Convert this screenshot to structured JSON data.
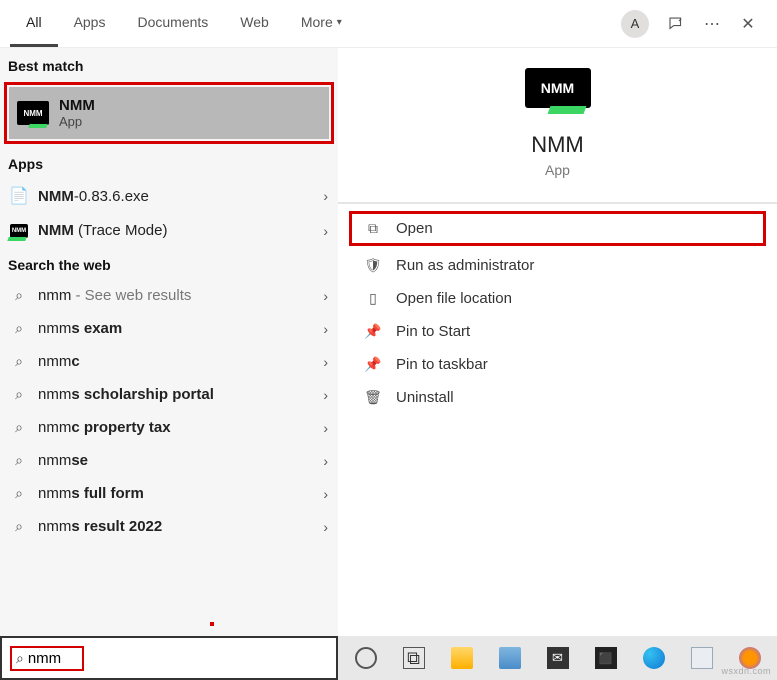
{
  "header": {
    "tabs": [
      "All",
      "Apps",
      "Documents",
      "Web",
      "More"
    ],
    "avatar": "A"
  },
  "sections": {
    "best_match": "Best match",
    "apps": "Apps",
    "search_web": "Search the web"
  },
  "best": {
    "title": "NMM",
    "subtitle": "App"
  },
  "apps_list": [
    {
      "name_bold": "NMM",
      "name_rest": "-0.83.6.exe"
    },
    {
      "name_bold": "NMM",
      "name_rest": " (Trace Mode)"
    }
  ],
  "web_list": [
    {
      "prefix": "nmm",
      "bold": "",
      "suffix": " - See web results",
      "light": true
    },
    {
      "prefix": "nmm",
      "bold": "s exam",
      "suffix": ""
    },
    {
      "prefix": "nmm",
      "bold": "c",
      "suffix": ""
    },
    {
      "prefix": "nmm",
      "bold": "s scholarship portal",
      "suffix": ""
    },
    {
      "prefix": "nmm",
      "bold": "c property tax",
      "suffix": ""
    },
    {
      "prefix": "nmm",
      "bold": "se",
      "suffix": ""
    },
    {
      "prefix": "nmm",
      "bold": "s full form",
      "suffix": ""
    },
    {
      "prefix": "nmm",
      "bold": "s result 2022",
      "suffix": ""
    }
  ],
  "details": {
    "name": "NMM",
    "type": "App",
    "actions": [
      "Open",
      "Run as administrator",
      "Open file location",
      "Pin to Start",
      "Pin to taskbar",
      "Uninstall"
    ]
  },
  "search_value": "nmm",
  "watermark": "wsxdn.com"
}
